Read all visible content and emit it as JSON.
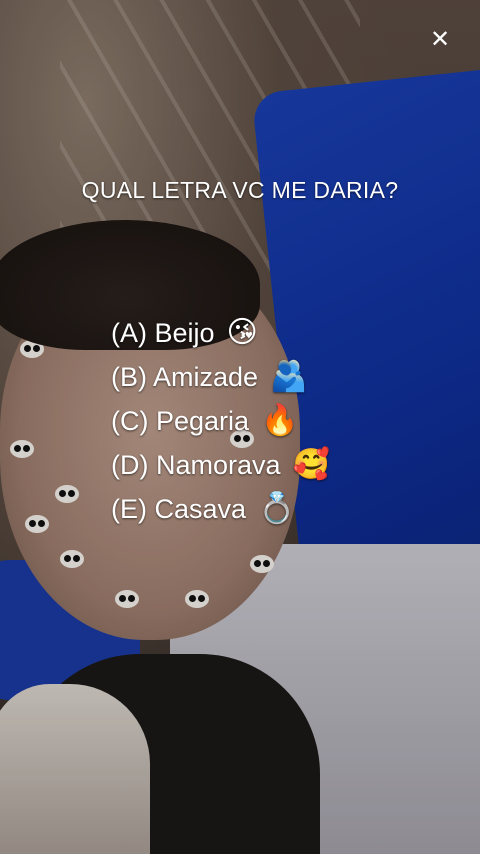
{
  "question": "QUAL LETRA VC ME DARIA?",
  "logo_icon": "capcut-logo-icon",
  "options": [
    {
      "label": "(A) Beijo",
      "emoji": "😘"
    },
    {
      "label": "(B) Amizade",
      "emoji": "🫂"
    },
    {
      "label": "(C) Pegaria",
      "emoji": "🔥"
    },
    {
      "label": "(D) Namorava",
      "emoji": "🥰"
    },
    {
      "label": "(E) Casava",
      "emoji": "💍"
    }
  ]
}
